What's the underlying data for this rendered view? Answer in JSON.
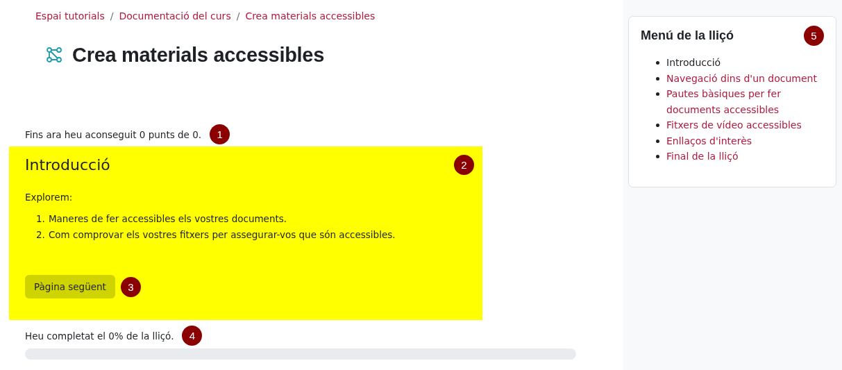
{
  "breadcrumb": [
    "Espai tutorials",
    "Documentació del curs",
    "Crea materials accessibles"
  ],
  "breadcrumb_separator": "/",
  "title": "Crea materials accessibles",
  "score": {
    "text": "Fins ara heu aconseguit 0 punts de 0.",
    "marker": "1"
  },
  "page": {
    "heading": "Introducció",
    "marker": "2",
    "intro": "Explorem:",
    "items": [
      {
        "number": "1.",
        "text": "Maneres de fer accessibles els vostres documents."
      },
      {
        "number": "2.",
        "text": "Com comprovar els vostres fitxers per assegurar-vos que són accessibles."
      }
    ],
    "button": {
      "label": "Pàgina següent",
      "marker": "3"
    }
  },
  "progress": {
    "text": "Heu completat el 0% de la lliçó.",
    "marker": "4",
    "level": 0
  },
  "menu": {
    "title": "Menú de la lliçó",
    "marker": "5",
    "items": [
      {
        "label": "Introducció",
        "selected": true
      },
      {
        "label": "Navegació dins d'un document",
        "selected": false
      },
      {
        "label": "Pautes bàsiques per fer documents accessibles",
        "selected": false
      },
      {
        "label": "Fitxers de vídeo accessibles",
        "selected": false
      },
      {
        "label": "Enllaços d'interès",
        "selected": false
      },
      {
        "label": "Final de la lliçó",
        "selected": false
      }
    ]
  }
}
